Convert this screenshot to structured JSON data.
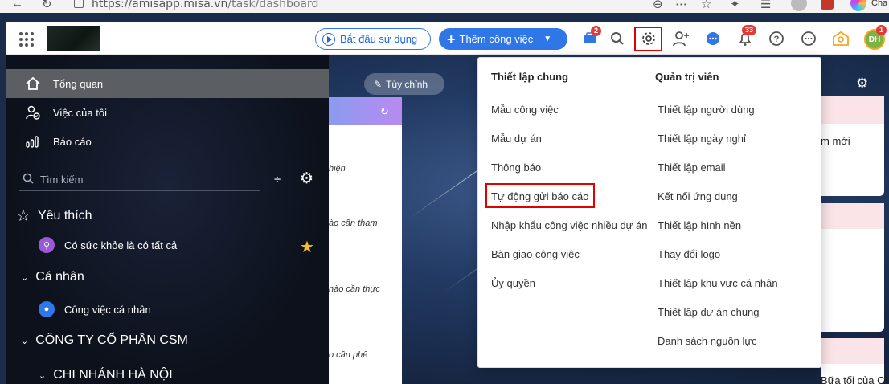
{
  "browser": {
    "url_host": "https://amisapp.misa.vn",
    "url_path": "/task/dashboard",
    "profile_label": "Cha"
  },
  "header": {
    "start_button": "Bắt đầu sử dụng",
    "add_task_button": "Thêm công việc",
    "cart_badge": "2",
    "notif_badge": "33",
    "avatar_text": "ĐH",
    "avatar_badge": "1"
  },
  "sidebar": {
    "nav": [
      {
        "label": "Tổng quan",
        "icon": "home-icon"
      },
      {
        "label": "Việc của tôi",
        "icon": "user-check-icon"
      },
      {
        "label": "Báo cáo",
        "icon": "bar-chart-icon"
      }
    ],
    "search_placeholder": "Tìm kiếm",
    "favorites_title": "Yêu thích",
    "favorite_item": "Có sức khỏe là có tất cả",
    "personal_title": "Cá nhân",
    "personal_item": "Công việc cá nhân",
    "company_title": "CÔNG TY CỔ PHẦN CSM",
    "branch_title": "CHI NHÁNH HÀ NỘI"
  },
  "main": {
    "customize_button": "Tùy chỉnh",
    "left_card_lines": [
      "hiện",
      "ào cần tham",
      "nào cần thực",
      "o cần phê"
    ],
    "right_card_lines": [
      "m mới",
      "Bữa tối của Chung"
    ]
  },
  "dropdown": {
    "general_title": "Thiết lập chung",
    "general_items": [
      "Mẫu công việc",
      "Mẫu dự án",
      "Thông báo",
      "Tự động gửi báo cáo",
      "Nhập khẩu công việc nhiều dự án",
      "Bàn giao công việc",
      "Ủy quyền"
    ],
    "admin_title": "Quản trị viên",
    "admin_items": [
      "Thiết lập người dùng",
      "Thiết lập ngày nghỉ",
      "Thiết lập email",
      "Kết nối ứng dụng",
      "Thiết lập hình nền",
      "Thay đổi logo",
      "Thiết lập khu vực cá nhân",
      "Thiết lập dự án chung",
      "Danh sách nguồn lực"
    ]
  },
  "colors": {
    "primary": "#2f76e6",
    "highlight_border": "#e00000",
    "sidebar_active": "#5b5e63",
    "favorite_star": "#f2c12e"
  }
}
